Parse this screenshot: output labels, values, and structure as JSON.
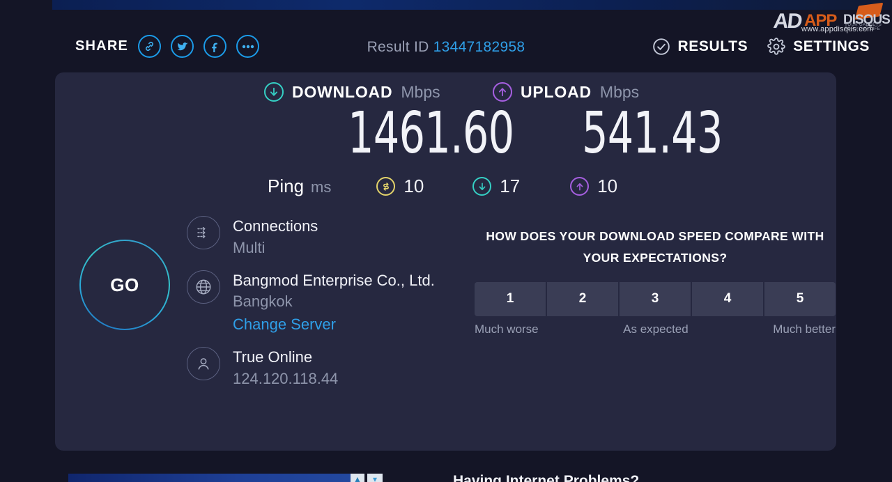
{
  "header": {
    "share_label": "SHARE",
    "share_icons": [
      {
        "name": "link-icon",
        "label": "Copy link"
      },
      {
        "name": "twitter-icon",
        "label": "Twitter"
      },
      {
        "name": "facebook-icon",
        "label": "Facebook"
      },
      {
        "name": "more-options-icon",
        "label": "More"
      }
    ],
    "result_id_label": "Result ID",
    "result_id_value": "13447182958",
    "results_label": "RESULTS",
    "settings_label": "SETTINGS"
  },
  "watermark": {
    "mark_ad": "AD",
    "mark_app": "APP",
    "mark_disqus": "DISQUS",
    "tagline": "YOUR GADGETS FOR YOUR LIFE",
    "url": "www.appdisqus.com"
  },
  "results": {
    "download": {
      "title": "DOWNLOAD",
      "unit": "Mbps",
      "value": "1461.60",
      "color": "#35cfc4"
    },
    "upload": {
      "title": "UPLOAD",
      "unit": "Mbps",
      "value": "541.43",
      "color": "#a65fe0"
    },
    "ping": {
      "label": "Ping",
      "unit": "ms",
      "idle_value": "10",
      "download_value": "17",
      "upload_value": "10",
      "idle_color": "#e3d36a"
    },
    "go_button_label": "GO"
  },
  "info": {
    "connections_title": "Connections",
    "connections_value": "Multi",
    "server_name": "Bangmod Enterprise Co., Ltd.",
    "server_city": "Bangkok",
    "change_server_label": "Change Server",
    "isp_name": "True Online",
    "ip_address": "124.120.118.44"
  },
  "survey": {
    "question": "HOW DOES YOUR DOWNLOAD SPEED COMPARE WITH YOUR EXPECTATIONS?",
    "ratings": [
      "1",
      "2",
      "3",
      "4",
      "5"
    ],
    "label_low": "Much worse",
    "label_mid": "As expected",
    "label_high": "Much better"
  },
  "bottom": {
    "promo_title": "Having Internet Problems?"
  }
}
